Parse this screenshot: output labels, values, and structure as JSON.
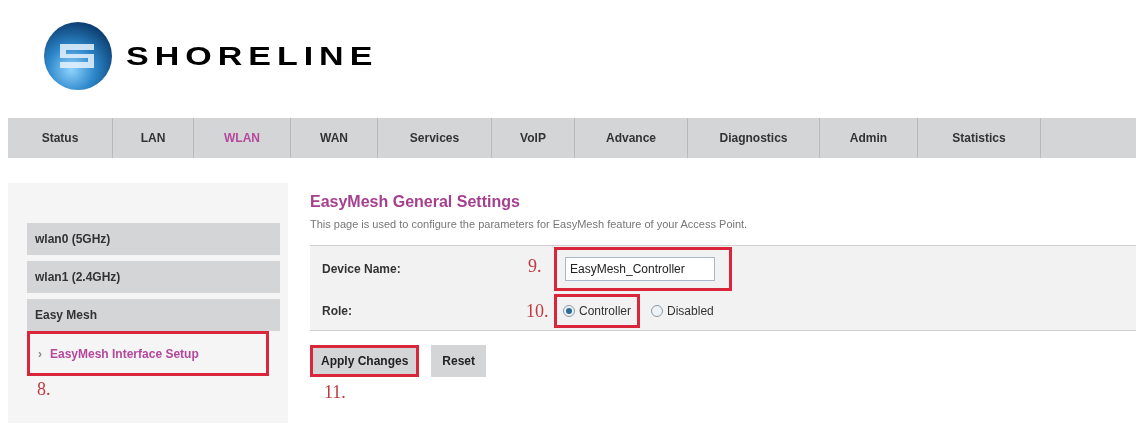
{
  "logo": {
    "text": "SHORELINE"
  },
  "nav": [
    {
      "label": "Status",
      "selected": false
    },
    {
      "label": "LAN",
      "selected": false
    },
    {
      "label": "WLAN",
      "selected": true
    },
    {
      "label": "WAN",
      "selected": false
    },
    {
      "label": "Services",
      "selected": false
    },
    {
      "label": "VoIP",
      "selected": false
    },
    {
      "label": "Advance",
      "selected": false
    },
    {
      "label": "Diagnostics",
      "selected": false
    },
    {
      "label": "Admin",
      "selected": false
    },
    {
      "label": "Statistics",
      "selected": false
    }
  ],
  "sidebar": {
    "items": [
      {
        "label": "wlan0 (5GHz)"
      },
      {
        "label": "wlan1 (2.4GHz)"
      },
      {
        "label": "Easy Mesh",
        "children": [
          {
            "label": "EasyMesh Interface Setup",
            "bullet": "›",
            "highlighted": true,
            "callout": "8."
          }
        ]
      }
    ]
  },
  "main": {
    "title": "EasyMesh General Settings",
    "description": "This page is used to configure the parameters for EasyMesh feature of your Access Point.",
    "device_name": {
      "label": "Device Name:",
      "value": "EasyMesh_Controller",
      "highlighted": true,
      "callout": "9."
    },
    "role": {
      "label": "Role:",
      "callout": "10.",
      "options": [
        {
          "label": "Controller",
          "selected": true,
          "highlighted": true
        },
        {
          "label": "Disabled",
          "selected": false,
          "highlighted": false
        }
      ]
    },
    "buttons": [
      {
        "label": "Apply Changes",
        "highlighted": true,
        "callout": "11."
      },
      {
        "label": "Reset",
        "highlighted": false
      }
    ]
  }
}
